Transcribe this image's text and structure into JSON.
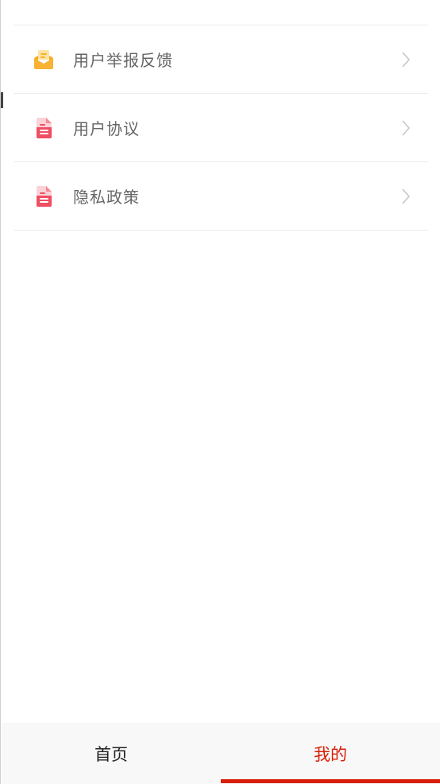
{
  "menu": {
    "items": [
      {
        "label": "用户举报反馈",
        "icon": "mail-icon",
        "icon_color": "#f9b233"
      },
      {
        "label": "用户协议",
        "icon": "document-icon",
        "icon_color": "#f04e63"
      },
      {
        "label": "隐私政策",
        "icon": "document-icon",
        "icon_color": "#f04e63"
      }
    ]
  },
  "tabbar": {
    "home_label": "首页",
    "mine_label": "我的",
    "active_tab": "我的",
    "active_color": "#d81e06"
  }
}
